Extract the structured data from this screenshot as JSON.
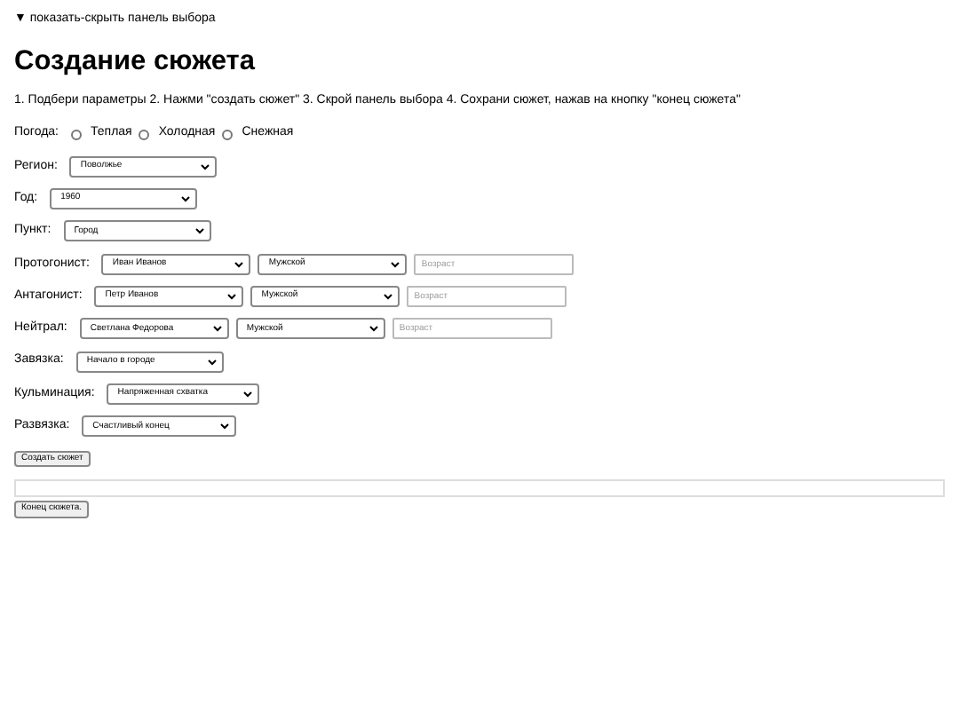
{
  "toggle": {
    "label": "▼ показать-скрыть панель выбора"
  },
  "heading": "Создание сюжета",
  "instructions": "1. Подбери параметры 2. Нажми \"создать сюжет\" 3. Скрой панель выбора 4. Сохрани сюжет, нажав на кнопку \"конец сюжета\"",
  "fields": [
    {
      "kind": "radio",
      "label": "Погода:",
      "options": [
        {
          "label": "Теплая",
          "selected": false
        },
        {
          "label": "Холодная",
          "selected": false
        },
        {
          "label": "Снежная",
          "selected": false
        }
      ]
    },
    {
      "kind": "select",
      "label": "Регион:",
      "value": "Поволжье"
    },
    {
      "kind": "select",
      "label": "Год:",
      "value": "1960"
    },
    {
      "kind": "select",
      "label": "Пункт:",
      "value": "Город"
    },
    {
      "kind": "person",
      "label": "Протогонист:",
      "name": "Иван Иванов",
      "gender": "Мужской",
      "age_placeholder": "Возраст"
    },
    {
      "kind": "person",
      "label": "Антагонист:",
      "name": "Петр Иванов",
      "gender": "Мужской",
      "age_placeholder": "Возраст"
    },
    {
      "kind": "person",
      "label": "Нейтрал:",
      "name": "Светлана Федорова",
      "gender": "Мужской",
      "age_placeholder": "Возраст"
    },
    {
      "kind": "select",
      "label": "Завязка:",
      "value": "Начало в городе"
    },
    {
      "kind": "select",
      "label": "Кульминация:",
      "value": "Напряженная схватка"
    },
    {
      "kind": "select",
      "label": "Развязка:",
      "value": "Счастливый конец"
    }
  ],
  "create_button": "Создать сюжет",
  "end_button": "Конец сюжета."
}
